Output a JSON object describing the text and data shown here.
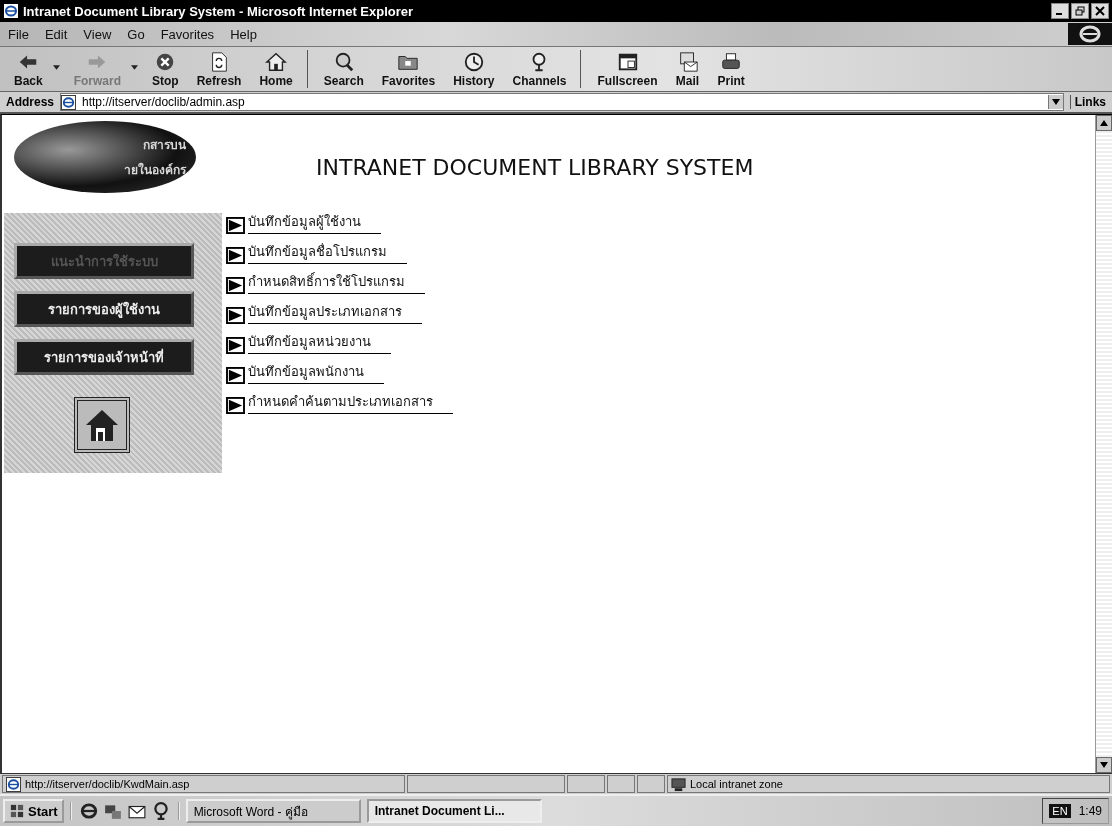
{
  "window": {
    "title": "Intranet Document Library System - Microsoft Internet Explorer"
  },
  "menu": [
    "File",
    "Edit",
    "View",
    "Go",
    "Favorites",
    "Help"
  ],
  "toolbar": [
    {
      "label": "Back",
      "disabled": false,
      "dropdown": true
    },
    {
      "label": "Forward",
      "disabled": true,
      "dropdown": true
    },
    {
      "label": "Stop",
      "disabled": false,
      "dropdown": false
    },
    {
      "label": "Refresh",
      "disabled": false,
      "dropdown": false
    },
    {
      "label": "Home",
      "disabled": false,
      "dropdown": false
    },
    {
      "label": "Search",
      "disabled": false,
      "dropdown": false
    },
    {
      "label": "Favorites",
      "disabled": false,
      "dropdown": false
    },
    {
      "label": "History",
      "disabled": false,
      "dropdown": false
    },
    {
      "label": "Channels",
      "disabled": false,
      "dropdown": false
    },
    {
      "label": "Fullscreen",
      "disabled": false,
      "dropdown": false
    },
    {
      "label": "Mail",
      "disabled": false,
      "dropdown": false
    },
    {
      "label": "Print",
      "disabled": false,
      "dropdown": false
    }
  ],
  "address": {
    "label": "Address",
    "value": "http://itserver/doclib/admin.asp",
    "links": "Links"
  },
  "page": {
    "logo_lines": [
      "กสารบน",
      "ายในองค์กร"
    ],
    "heading": "INTRANET DOCUMENT LIBRARY SYSTEM",
    "side_buttons": [
      {
        "label": "แนะนำการใช้ระบบ",
        "disabled": true
      },
      {
        "label": "รายการของผู้ใช้งาน",
        "disabled": false
      },
      {
        "label": "รายการของเจ้าหน้าที่",
        "disabled": false
      }
    ],
    "links": [
      "บันทึกข้อมูลผู้ใช้งาน",
      "บันทึกข้อมูลชื่อโปรแกรม",
      "กำหนดสิทธิ์การใช้โปรแกรม",
      "บันทึกข้อมูลประเภทเอกสาร",
      "บันทึกข้อมูลหน่วยงาน",
      "บันทึกข้อมูลพนักงาน",
      "กำหนดคำค้นตามประเภทเอกสาร"
    ]
  },
  "status_bar": {
    "url": "http://itserver/doclib/KwdMain.asp",
    "zone": "Local intranet zone"
  },
  "taskbar": {
    "start": "Start",
    "tasks": [
      {
        "label": "Microsoft Word - คู่มือ",
        "selected": false
      },
      {
        "label": "Intranet Document Li...",
        "selected": true
      }
    ],
    "language": "EN",
    "time": "1:49"
  }
}
